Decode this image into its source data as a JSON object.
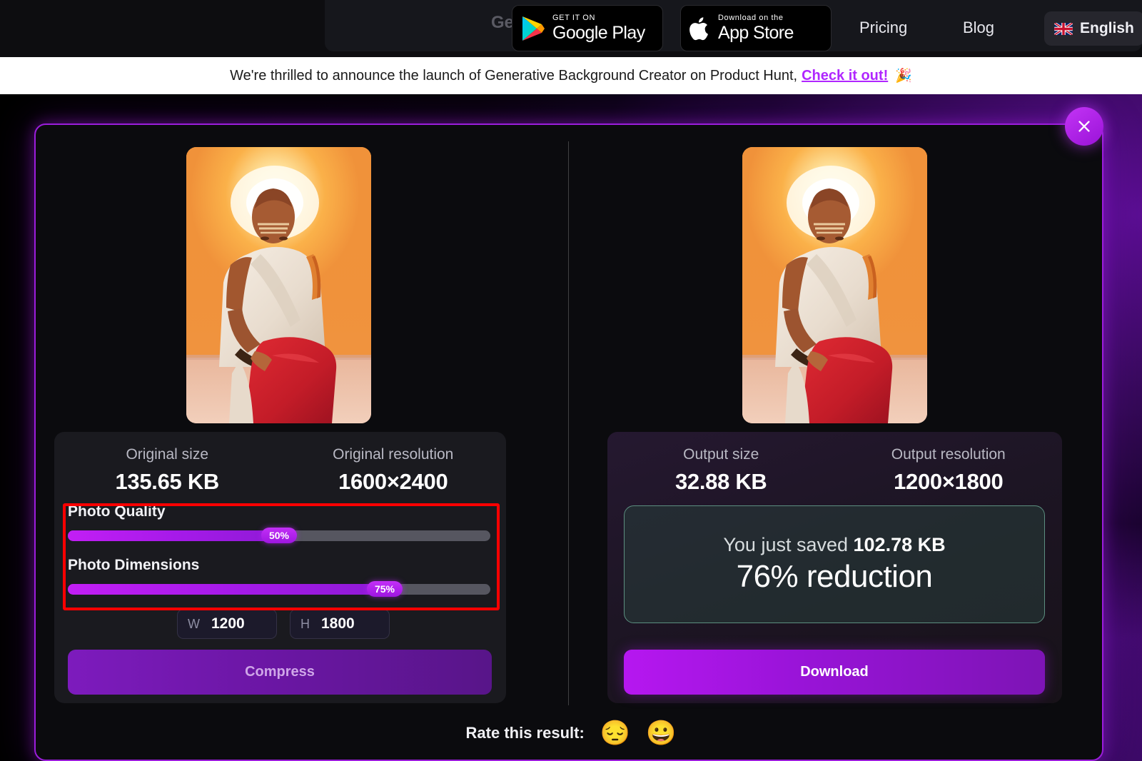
{
  "header": {
    "brand_partial": "Ge",
    "google_play": {
      "top": "GET IT ON",
      "bottom": "Google Play",
      "icon": "google-play-icon"
    },
    "app_store": {
      "top": "Download on the",
      "bottom": "App Store",
      "icon": "apple-icon"
    },
    "nav": [
      {
        "label": "Pricing"
      },
      {
        "label": "Blog"
      }
    ],
    "language": {
      "label": "English",
      "flag": "uk-flag-icon"
    }
  },
  "announcement": {
    "text": "We're thrilled to announce the launch of Generative Background Creator on Product Hunt,",
    "link": "Check it out!",
    "emoji": "🎉"
  },
  "modal": {
    "close_label": "×",
    "close_icon": "close-icon",
    "original": {
      "size_label": "Original size",
      "size_value": "135.65 KB",
      "resolution_label": "Original resolution",
      "resolution_value": "1600×2400"
    },
    "output": {
      "size_label": "Output size",
      "size_value": "32.88 KB",
      "resolution_label": "Output resolution",
      "resolution_value": "1200×1800"
    },
    "sliders": [
      {
        "label": "Photo Quality",
        "value": 50,
        "display": "50%"
      },
      {
        "label": "Photo Dimensions",
        "value": 75,
        "display": "75%"
      }
    ],
    "dimensions": {
      "width_key": "W",
      "width_value": "1200",
      "height_key": "H",
      "height_value": "1800"
    },
    "compress_button": "Compress",
    "download_button": "Download",
    "savings": {
      "prefix": "You just saved ",
      "amount": "102.78 KB",
      "reduction": "76% reduction"
    },
    "rate": {
      "label": "Rate this result:",
      "emojis": [
        "😔",
        "😀"
      ]
    }
  },
  "colors": {
    "accent_purple": "#b026ff",
    "modal_border": "#9b1ddb",
    "highlight_red": "#ff0000",
    "savings_border": "#5c8f80",
    "slider_track": "#565660"
  }
}
